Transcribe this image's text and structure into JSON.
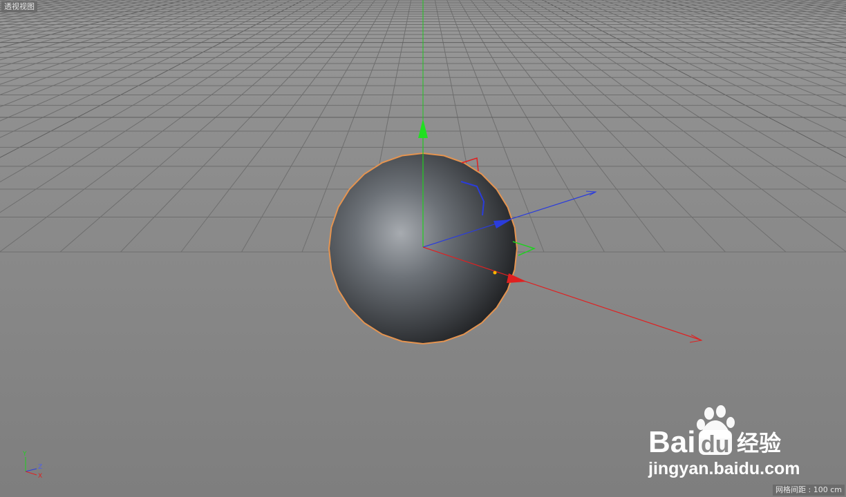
{
  "viewport": {
    "label": "透视视图",
    "grid_spacing": "网格间距 : 100 cm"
  },
  "orientation_axes": {
    "y": "Y",
    "z": "Z",
    "x": "X"
  },
  "watermark": {
    "brand_left": "Bai",
    "brand_right": "du",
    "brand_cn": "经验",
    "url": "jingyan.baidu.com"
  },
  "colors": {
    "x_axis": "#e02020",
    "y_axis": "#20d020",
    "z_axis": "#2a3cdc",
    "selection_outline": "#e59450"
  }
}
